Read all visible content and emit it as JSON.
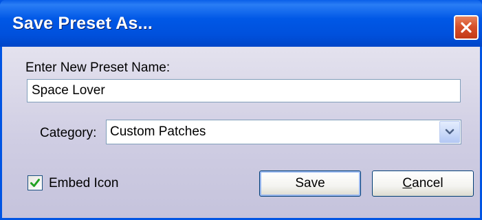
{
  "window": {
    "title": "Save Preset As..."
  },
  "form": {
    "name_label": "Enter New Preset Name:",
    "name_value": "Space Lover",
    "category_label": "Category:",
    "category_value": "Custom Patches",
    "embed_label": "Embed Icon",
    "embed_checked": true
  },
  "buttons": {
    "save_label": "Save",
    "cancel_mnemonic": "C",
    "cancel_rest": "ancel"
  },
  "icons": {
    "close": "close-icon",
    "dropdown": "chevron-down-icon",
    "check": "checkmark-icon"
  },
  "colors": {
    "titlebar": "#0054e3",
    "close_button": "#d8512b",
    "checkmark": "#21a121",
    "dialog_background": "#cfcde3"
  }
}
